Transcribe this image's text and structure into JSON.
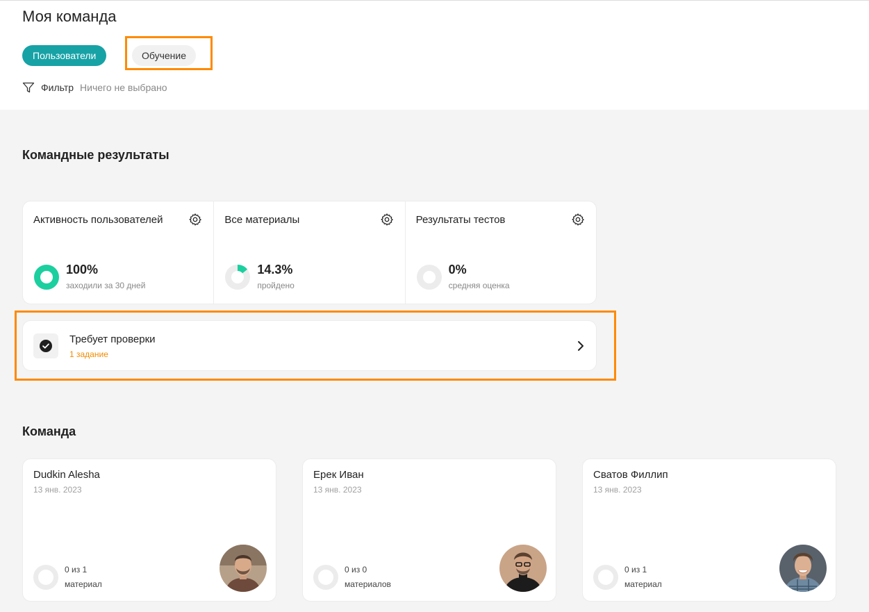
{
  "header": {
    "title": "Моя команда",
    "tabs": [
      {
        "label": "Пользователи",
        "active": true
      },
      {
        "label": "Обучение",
        "active": false
      }
    ],
    "filter": {
      "label": "Фильтр",
      "value": "Ничего не выбрано",
      "icon": "filter-icon"
    }
  },
  "team_results": {
    "title": "Командные результаты",
    "stats": [
      {
        "title": "Активность пользователей",
        "value": "100%",
        "sub": "заходили за 30 дней",
        "percent": 100,
        "icon": "gear-icon"
      },
      {
        "title": "Все материалы",
        "value": "14.3%",
        "sub": "пройдено",
        "percent": 14.3,
        "icon": "gear-icon"
      },
      {
        "title": "Результаты тестов",
        "value": "0%",
        "sub": "средняя оценка",
        "percent": 0,
        "icon": "gear-icon"
      }
    ]
  },
  "review": {
    "title": "Требует проверки",
    "sub": "1 задание",
    "icon": "check-circle-icon",
    "arrow_icon": "chevron-right-icon"
  },
  "team": {
    "title": "Команда",
    "members": [
      {
        "name": "Dudkin Alesha",
        "date": "13 янв. 2023",
        "count": "0 из 1",
        "unit": "материал"
      },
      {
        "name": "Ерек Иван",
        "date": "13 янв. 2023",
        "count": "0 из 0",
        "unit": "материалов"
      },
      {
        "name": "Сватов Филлип",
        "date": "13 янв. 2023",
        "count": "0 из 1",
        "unit": "материал"
      }
    ]
  },
  "colors": {
    "accent": "#17a2a6",
    "progress": "#1ccf9f",
    "highlight": "#ff8a00",
    "warning_text": "#f28c00"
  }
}
